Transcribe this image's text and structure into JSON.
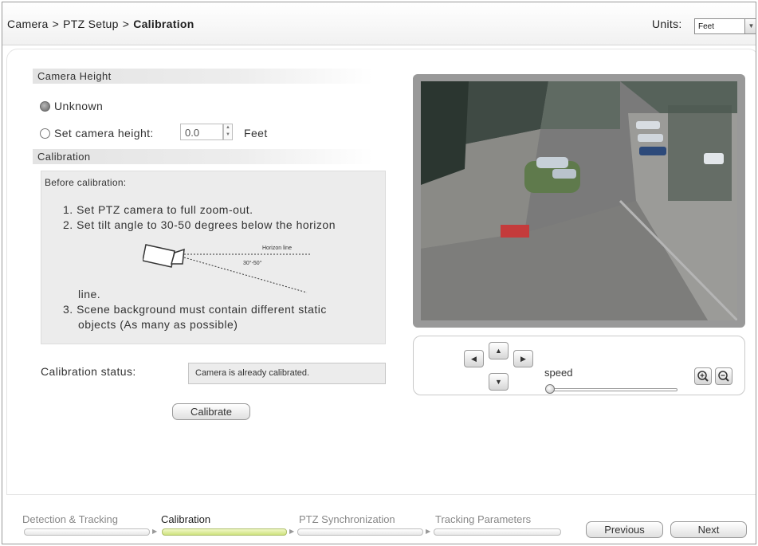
{
  "header": {
    "breadcrumb": [
      "Camera",
      "PTZ Setup",
      "Calibration"
    ],
    "separator": ">",
    "units_label": "Units:",
    "units_value": "Feet"
  },
  "camera_height": {
    "title": "Camera Height",
    "option_unknown": "Unknown",
    "option_set": "Set camera height:",
    "height_value": "0.0",
    "height_unit": "Feet",
    "selected": "Unknown"
  },
  "calibration": {
    "title": "Calibration",
    "before": "Before calibration:",
    "steps": [
      "1.  Set PTZ camera to full zoom-out.",
      "2.  Set tilt angle to 30-50 degrees below the horizon",
      "line.",
      "3.  Scene background must contain different static",
      "objects (As many as possible)"
    ],
    "diagram": {
      "horizon_label": "Horizon line",
      "angle_label": "30°-50°"
    },
    "status_label": "Calibration status:",
    "status_value": "Camera is already calibrated.",
    "calibrate_button": "Calibrate"
  },
  "ptz": {
    "speed_label": "speed",
    "speed_value": 0,
    "icons": [
      "arrow-left-icon",
      "arrow-up-icon",
      "arrow-right-icon",
      "arrow-down-icon",
      "zoom-in-icon",
      "zoom-out-icon"
    ]
  },
  "wizard": {
    "steps": [
      "Detection & Tracking",
      "Calibration",
      "PTZ Synchronization",
      "Tracking Parameters"
    ],
    "active_step": "Calibration",
    "previous_button": "Previous",
    "next_button": "Next"
  },
  "colors": {
    "active_step_bar": "#cfe27e",
    "panel_gray": "#ececec",
    "video_frame": "#999999"
  }
}
